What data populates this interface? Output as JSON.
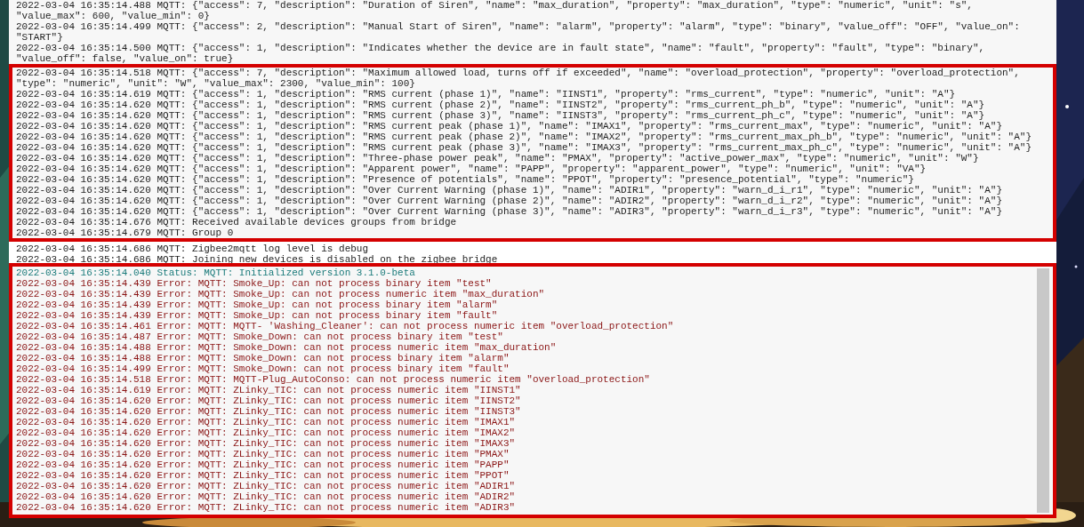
{
  "log_panel": {
    "entries": [
      {
        "text": "2022-03-04 16:35:14.488 MQTT: {\"access\": 7, \"description\": \"Duration of Siren\", \"name\": \"max_duration\", \"property\": \"max_duration\", \"type\": \"numeric\", \"unit\": \"s\", \"value_max\": 600, \"value_min\": 0}"
      },
      {
        "text": "2022-03-04 16:35:14.499 MQTT: {\"access\": 2, \"description\": \"Manual Start of Siren\", \"name\": \"alarm\", \"property\": \"alarm\", \"type\": \"binary\", \"value_off\": \"OFF\", \"value_on\": \"START\"}"
      },
      {
        "text": "2022-03-04 16:35:14.500 MQTT: {\"access\": 1, \"description\": \"Indicates whether the device are in fault state\", \"name\": \"fault\", \"property\": \"fault\", \"type\": \"binary\", \"value_off\": false, \"value_on\": true}"
      }
    ],
    "highlighted_entries": [
      {
        "text": "2022-03-04 16:35:14.518 MQTT: {\"access\": 7, \"description\": \"Maximum allowed load, turns off if exceeded\", \"name\": \"overload_protection\", \"property\": \"overload_protection\", \"type\": \"numeric\", \"unit\": \"W\", \"value_max\": 2300, \"value_min\": 100}"
      },
      {
        "text": "2022-03-04 16:35:14.619 MQTT: {\"access\": 1, \"description\": \"RMS current (phase 1)\", \"name\": \"IINST1\", \"property\": \"rms_current\", \"type\": \"numeric\", \"unit\": \"A\"}"
      },
      {
        "text": "2022-03-04 16:35:14.620 MQTT: {\"access\": 1, \"description\": \"RMS current (phase 2)\", \"name\": \"IINST2\", \"property\": \"rms_current_ph_b\", \"type\": \"numeric\", \"unit\": \"A\"}"
      },
      {
        "text": "2022-03-04 16:35:14.620 MQTT: {\"access\": 1, \"description\": \"RMS current (phase 3)\", \"name\": \"IINST3\", \"property\": \"rms_current_ph_c\", \"type\": \"numeric\", \"unit\": \"A\"}"
      },
      {
        "text": "2022-03-04 16:35:14.620 MQTT: {\"access\": 1, \"description\": \"RMS current peak (phase 1)\", \"name\": \"IMAX1\", \"property\": \"rms_current_max\", \"type\": \"numeric\", \"unit\": \"A\"}"
      },
      {
        "text": "2022-03-04 16:35:14.620 MQTT: {\"access\": 1, \"description\": \"RMS current peak (phase 2)\", \"name\": \"IMAX2\", \"property\": \"rms_current_max_ph_b\", \"type\": \"numeric\", \"unit\": \"A\"}"
      },
      {
        "text": "2022-03-04 16:35:14.620 MQTT: {\"access\": 1, \"description\": \"RMS current peak (phase 3)\", \"name\": \"IMAX3\", \"property\": \"rms_current_max_ph_c\", \"type\": \"numeric\", \"unit\": \"A\"}"
      },
      {
        "text": "2022-03-04 16:35:14.620 MQTT: {\"access\": 1, \"description\": \"Three-phase power peak\", \"name\": \"PMAX\", \"property\": \"active_power_max\", \"type\": \"numeric\", \"unit\": \"W\"}"
      },
      {
        "text": "2022-03-04 16:35:14.620 MQTT: {\"access\": 1, \"description\": \"Apparent power\", \"name\": \"PAPP\", \"property\": \"apparent_power\", \"type\": \"numeric\", \"unit\": \"VA\"}"
      },
      {
        "text": "2022-03-04 16:35:14.620 MQTT: {\"access\": 1, \"description\": \"Presence of potentials\", \"name\": \"PPOT\", \"property\": \"presence_potential\", \"type\": \"numeric\"}"
      },
      {
        "text": "2022-03-04 16:35:14.620 MQTT: {\"access\": 1, \"description\": \"Over Current Warning (phase 1)\", \"name\": \"ADIR1\", \"property\": \"warn_d_i_r1\", \"type\": \"numeric\", \"unit\": \"A\"}"
      },
      {
        "text": "2022-03-04 16:35:14.620 MQTT: {\"access\": 1, \"description\": \"Over Current Warning (phase 2)\", \"name\": \"ADIR2\", \"property\": \"warn_d_i_r2\", \"type\": \"numeric\", \"unit\": \"A\"}"
      },
      {
        "text": "2022-03-04 16:35:14.620 MQTT: {\"access\": 1, \"description\": \"Over Current Warning (phase 3)\", \"name\": \"ADIR3\", \"property\": \"warn_d_i_r3\", \"type\": \"numeric\", \"unit\": \"A\"}"
      },
      {
        "text": "2022-03-04 16:35:14.676 MQTT: Received available devices groups from bridge"
      },
      {
        "text": "2022-03-04 16:35:14.679 MQTT: Group 0"
      }
    ]
  },
  "bridge_panel": {
    "entries": [
      {
        "text": "2022-03-04 16:35:14.686 MQTT: Zigbee2mqtt log level is debug"
      },
      {
        "text": "2022-03-04 16:35:14.686 MQTT: Joining new devices is disabled on the zigbee bridge"
      }
    ]
  },
  "error_panel": {
    "entries": [
      {
        "kind": "status",
        "text": "2022-03-04 16:35:14.040 Status: MQTT: Initialized version 3.1.0-beta"
      },
      {
        "kind": "error",
        "text": "2022-03-04 16:35:14.439 Error: MQTT: Smoke_Up: can not process binary item \"test\""
      },
      {
        "kind": "error",
        "text": "2022-03-04 16:35:14.439 Error: MQTT: Smoke_Up: can not process numeric item \"max_duration\""
      },
      {
        "kind": "error",
        "text": "2022-03-04 16:35:14.439 Error: MQTT: Smoke_Up: can not process binary item \"alarm\""
      },
      {
        "kind": "error",
        "text": "2022-03-04 16:35:14.439 Error: MQTT: Smoke_Up: can not process binary item \"fault\""
      },
      {
        "kind": "error",
        "text": "2022-03-04 16:35:14.461 Error: MQTT: MQTT- 'Washing_Cleaner': can not process numeric item \"overload_protection\""
      },
      {
        "kind": "error",
        "text": "2022-03-04 16:35:14.487 Error: MQTT: Smoke_Down: can not process binary item \"test\""
      },
      {
        "kind": "error",
        "text": "2022-03-04 16:35:14.488 Error: MQTT: Smoke_Down: can not process numeric item \"max_duration\""
      },
      {
        "kind": "error",
        "text": "2022-03-04 16:35:14.488 Error: MQTT: Smoke_Down: can not process binary item \"alarm\""
      },
      {
        "kind": "error",
        "text": "2022-03-04 16:35:14.499 Error: MQTT: Smoke_Down: can not process binary item \"fault\""
      },
      {
        "kind": "error",
        "text": "2022-03-04 16:35:14.518 Error: MQTT: MQTT-Plug_AutoConso: can not process numeric item \"overload_protection\""
      },
      {
        "kind": "error",
        "text": "2022-03-04 16:35:14.619 Error: MQTT: ZLinky_TIC: can not process numeric item \"IINST1\""
      },
      {
        "kind": "error",
        "text": "2022-03-04 16:35:14.620 Error: MQTT: ZLinky_TIC: can not process numeric item \"IINST2\""
      },
      {
        "kind": "error",
        "text": "2022-03-04 16:35:14.620 Error: MQTT: ZLinky_TIC: can not process numeric item \"IINST3\""
      },
      {
        "kind": "error",
        "text": "2022-03-04 16:35:14.620 Error: MQTT: ZLinky_TIC: can not process numeric item \"IMAX1\""
      },
      {
        "kind": "error",
        "text": "2022-03-04 16:35:14.620 Error: MQTT: ZLinky_TIC: can not process numeric item \"IMAX2\""
      },
      {
        "kind": "error",
        "text": "2022-03-04 16:35:14.620 Error: MQTT: ZLinky_TIC: can not process numeric item \"IMAX3\""
      },
      {
        "kind": "error",
        "text": "2022-03-04 16:35:14.620 Error: MQTT: ZLinky_TIC: can not process numeric item \"PMAX\""
      },
      {
        "kind": "error",
        "text": "2022-03-04 16:35:14.620 Error: MQTT: ZLinky_TIC: can not process numeric item \"PAPP\""
      },
      {
        "kind": "error",
        "text": "2022-03-04 16:35:14.620 Error: MQTT: ZLinky_TIC: can not process numeric item \"PPOT\""
      },
      {
        "kind": "error",
        "text": "2022-03-04 16:35:14.620 Error: MQTT: ZLinky_TIC: can not process numeric item \"ADIR1\""
      },
      {
        "kind": "error",
        "text": "2022-03-04 16:35:14.620 Error: MQTT: ZLinky_TIC: can not process numeric item \"ADIR2\""
      },
      {
        "kind": "error",
        "text": "2022-03-04 16:35:14.620 Error: MQTT: ZLinky_TIC: can not process numeric item \"ADIR3\""
      }
    ]
  }
}
